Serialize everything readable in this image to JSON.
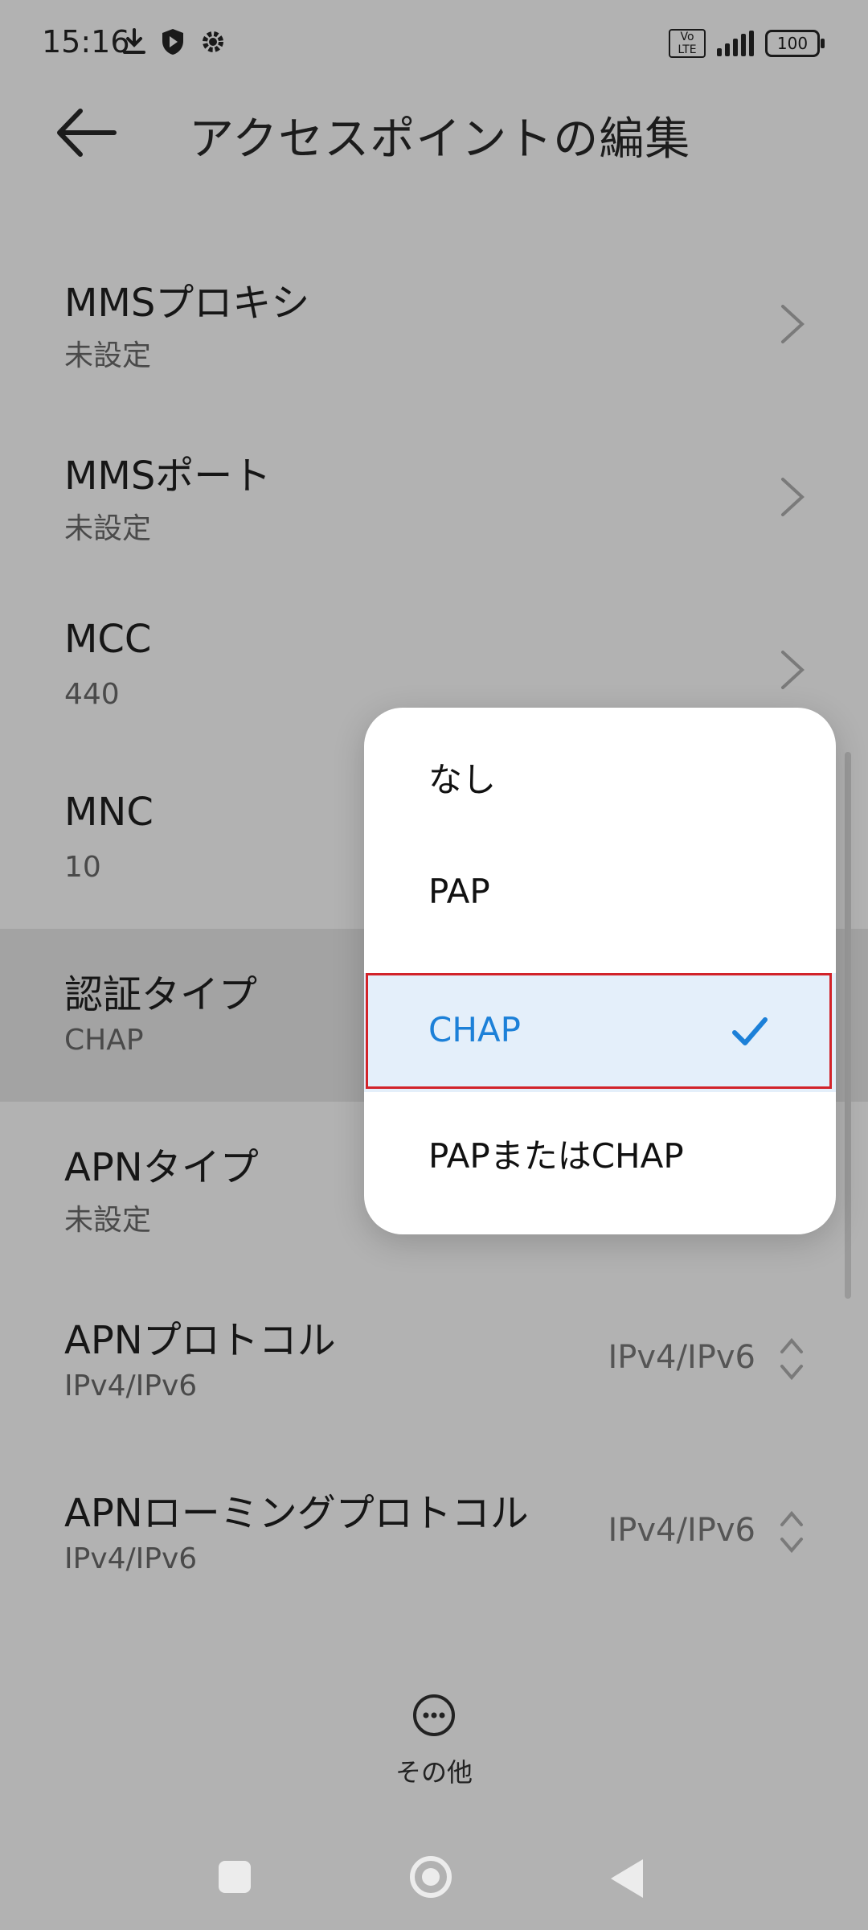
{
  "status_bar": {
    "time": "15:16",
    "volte": "Vo LTE",
    "battery": "100"
  },
  "header": {
    "title": "アクセスポイントの編集"
  },
  "rows": [
    {
      "label": "MMSプロキシ",
      "value": "未設定"
    },
    {
      "label": "MMSポート",
      "value": "未設定"
    },
    {
      "label": "MCC",
      "value": "440"
    },
    {
      "label": "MNC",
      "value": "10"
    },
    {
      "label": "認証タイプ",
      "value": "CHAP"
    },
    {
      "label": "APNタイプ",
      "value": "未設定"
    },
    {
      "label": "APNプロトコル",
      "value": "IPv4/IPv6",
      "right_value": "IPv4/IPv6"
    },
    {
      "label": "APNローミングプロトコル",
      "value": "IPv4/IPv6",
      "right_value": "IPv4/IPv6"
    }
  ],
  "popup": {
    "options": [
      "なし",
      "PAP",
      "CHAP",
      "PAPまたはCHAP"
    ],
    "selected": "CHAP"
  },
  "more": {
    "label": "その他"
  },
  "colors": {
    "accent": "#1c80d8",
    "selection_outline": "#d2232a",
    "overlay_bg": "#b2b2b2"
  }
}
